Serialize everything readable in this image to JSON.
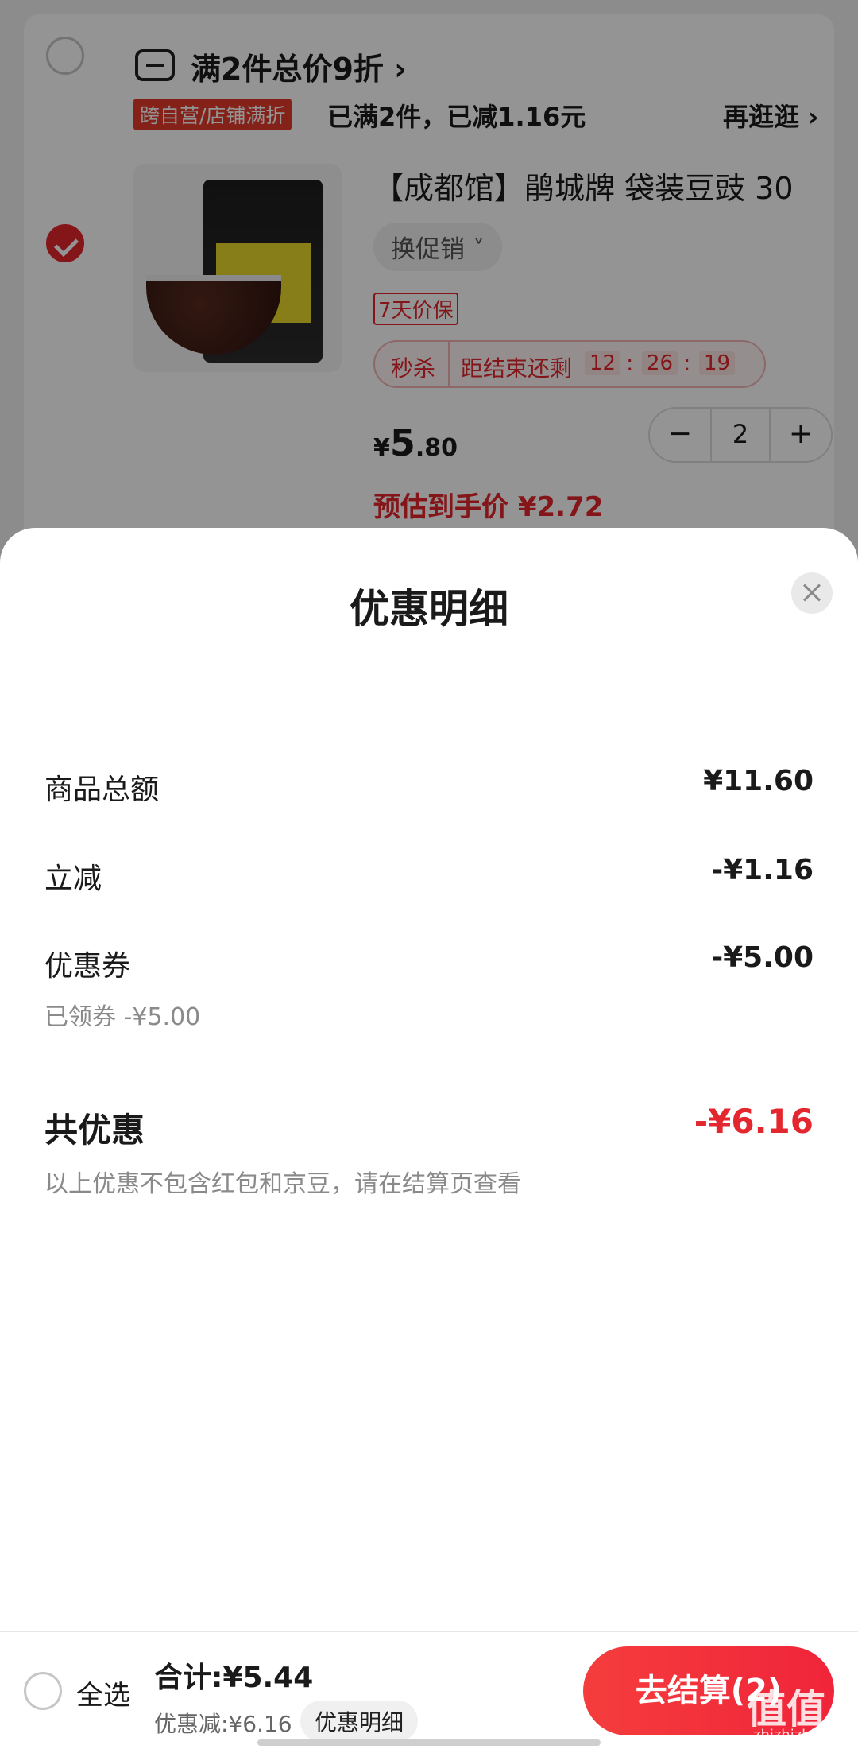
{
  "cart": {
    "promo_title": "满2件总价9折",
    "promo_chevron": "›",
    "promo_tag": "跨自营/店铺满折",
    "promo_status": "已满2件，已减1.16元",
    "promo_more": "再逛逛 ›",
    "product_title": "【成都馆】鹃城牌 袋装豆豉 30",
    "swap_promo": "换促销 ˅",
    "price_protect": "7天价保",
    "flash_label": "秒杀",
    "flash_text": "距结束还剩",
    "countdown": [
      "12",
      "26",
      "19"
    ],
    "countdown_sep": ":",
    "price_symbol": "¥",
    "price_int": "5",
    "price_dec": ".80",
    "qty": "2",
    "qty_minus": "−",
    "qty_plus": "+",
    "est_price": "预估到手价 ¥2.72",
    "accent": "#e4262e"
  },
  "sheet": {
    "title": "优惠明细",
    "rows": [
      {
        "label": "商品总额",
        "value": "¥11.60"
      },
      {
        "label": "立减",
        "value": "-¥1.16"
      },
      {
        "label": "优惠券",
        "value": "-¥5.00"
      }
    ],
    "coupon_note": "已领券 -¥5.00",
    "total_label": "共优惠",
    "total_value": "-¥6.16",
    "total_note": "以上优惠不包含红包和京豆，请在结算页查看"
  },
  "bottom_bar": {
    "select_all": "全选",
    "total": "合计:¥5.44",
    "discount": "优惠减:¥6.16",
    "detail_pill": "优惠明细",
    "checkout": "去结算(2)"
  },
  "watermark": {
    "main": "值值值",
    "sub": "zhizhizhi.com"
  }
}
